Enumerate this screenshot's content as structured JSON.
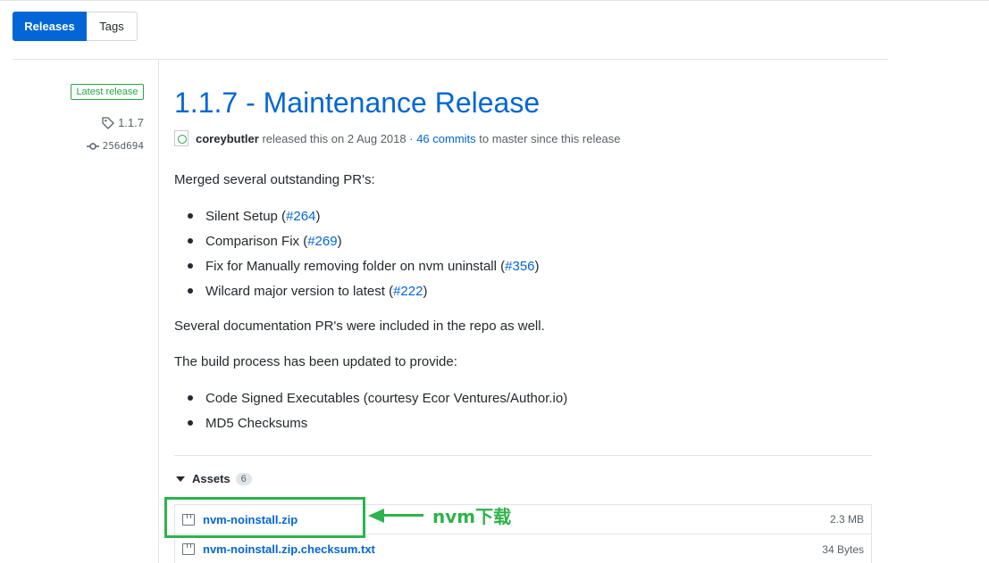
{
  "tabs": {
    "releases": "Releases",
    "tags": "Tags"
  },
  "sidebar": {
    "badge": "Latest release",
    "tag": "1.1.7",
    "commit": "256d694"
  },
  "release": {
    "title": "1.1.7 - Maintenance Release",
    "author": "coreybutler",
    "released_text": "released this on 2 Aug 2018 ·",
    "commits_link": "46 commits",
    "since_text": "to master since this release"
  },
  "body": {
    "intro": "Merged several outstanding PR's:",
    "pr_items": [
      {
        "text": "Silent Setup (",
        "link": "#264",
        "close": ")"
      },
      {
        "text": "Comparison Fix (",
        "link": "#269",
        "close": ")"
      },
      {
        "text": "Fix for Manually removing folder on nvm uninstall (",
        "link": "#356",
        "close": ")"
      },
      {
        "text": "Wilcard major version to latest (",
        "link": "#222",
        "close": ")"
      }
    ],
    "docs_note": "Several documentation PR's were included in the repo as well.",
    "build_intro": "The build process has been updated to provide:",
    "build_items": [
      "Code Signed Executables (courtesy Ecor Ventures/Author.io)",
      "MD5 Checksums"
    ]
  },
  "assets": {
    "label": "Assets",
    "count": "6",
    "items": [
      {
        "name": "nvm-noinstall.zip",
        "size": "2.3 MB"
      },
      {
        "name": "nvm-noinstall.zip.checksum.txt",
        "size": "34 Bytes"
      }
    ]
  },
  "annotation": {
    "text": "nvm下载",
    "color": "#2fb34c"
  },
  "colors": {
    "accent": "#0366d6",
    "success": "#28a745"
  }
}
